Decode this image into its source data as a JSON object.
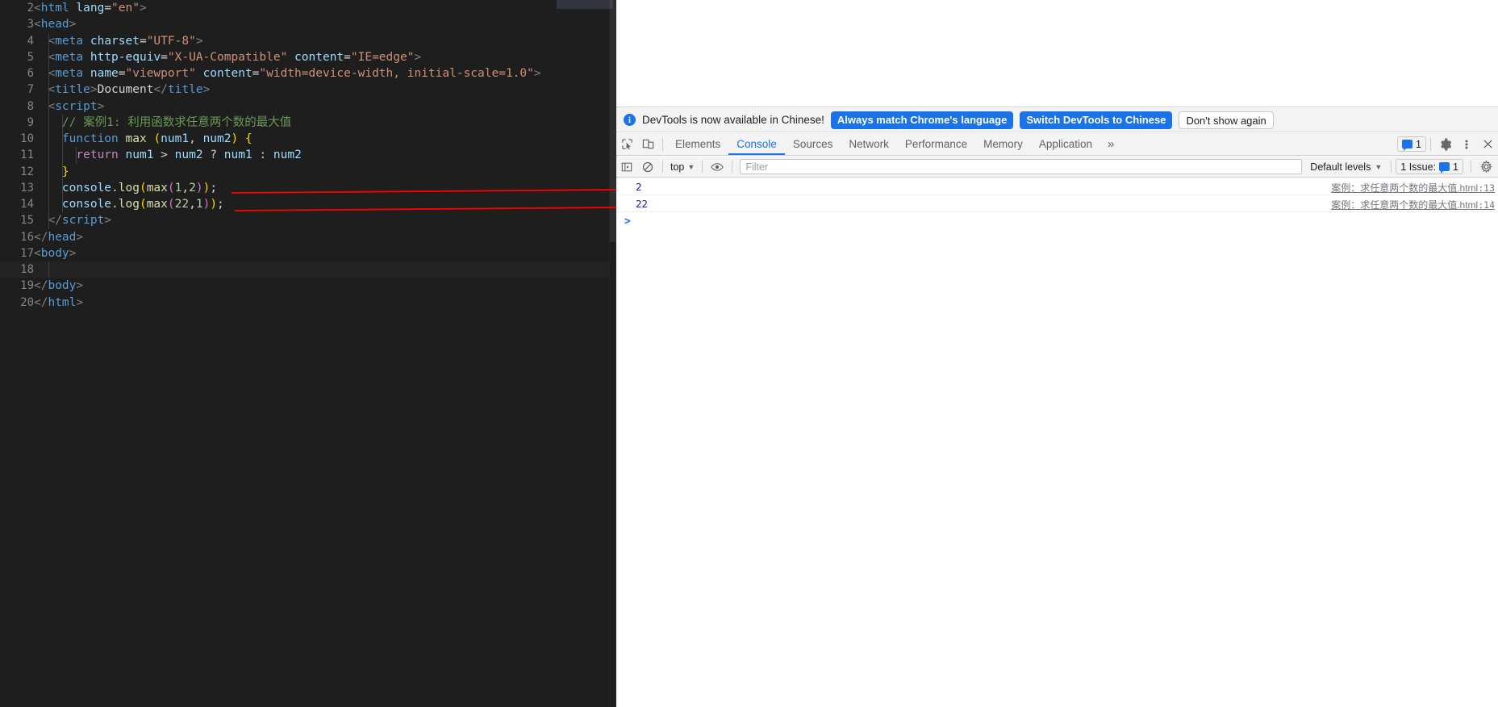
{
  "editor": {
    "first_visible_line": 2,
    "active_line": 18,
    "lines": [
      {
        "n": 2,
        "indent": 0,
        "tokens": [
          {
            "t": "punc",
            "s": "<"
          },
          {
            "t": "tag",
            "s": "html"
          },
          {
            "t": "plain",
            "s": " "
          },
          {
            "t": "attr",
            "s": "lang"
          },
          {
            "t": "plain",
            "s": "="
          },
          {
            "t": "str",
            "s": "\"en\""
          },
          {
            "t": "punc",
            "s": ">"
          }
        ]
      },
      {
        "n": 3,
        "indent": 0,
        "tokens": [
          {
            "t": "punc",
            "s": "<"
          },
          {
            "t": "tag",
            "s": "head"
          },
          {
            "t": "punc",
            "s": ">"
          }
        ]
      },
      {
        "n": 4,
        "indent": 1,
        "tokens": [
          {
            "t": "punc",
            "s": "  <"
          },
          {
            "t": "tag",
            "s": "meta"
          },
          {
            "t": "plain",
            "s": " "
          },
          {
            "t": "attr",
            "s": "charset"
          },
          {
            "t": "plain",
            "s": "="
          },
          {
            "t": "str",
            "s": "\"UTF-8\""
          },
          {
            "t": "punc",
            "s": ">"
          }
        ]
      },
      {
        "n": 5,
        "indent": 1,
        "tokens": [
          {
            "t": "punc",
            "s": "  <"
          },
          {
            "t": "tag",
            "s": "meta"
          },
          {
            "t": "plain",
            "s": " "
          },
          {
            "t": "attr",
            "s": "http-equiv"
          },
          {
            "t": "plain",
            "s": "="
          },
          {
            "t": "str",
            "s": "\"X-UA-Compatible\""
          },
          {
            "t": "plain",
            "s": " "
          },
          {
            "t": "attr",
            "s": "content"
          },
          {
            "t": "plain",
            "s": "="
          },
          {
            "t": "str",
            "s": "\"IE=edge\""
          },
          {
            "t": "punc",
            "s": ">"
          }
        ]
      },
      {
        "n": 6,
        "indent": 1,
        "tokens": [
          {
            "t": "punc",
            "s": "  <"
          },
          {
            "t": "tag",
            "s": "meta"
          },
          {
            "t": "plain",
            "s": " "
          },
          {
            "t": "attr",
            "s": "name"
          },
          {
            "t": "plain",
            "s": "="
          },
          {
            "t": "str",
            "s": "\"viewport\""
          },
          {
            "t": "plain",
            "s": " "
          },
          {
            "t": "attr",
            "s": "content"
          },
          {
            "t": "plain",
            "s": "="
          },
          {
            "t": "str",
            "s": "\"width=device-width, initial-scale=1.0\""
          },
          {
            "t": "punc",
            "s": ">"
          }
        ]
      },
      {
        "n": 7,
        "indent": 1,
        "tokens": [
          {
            "t": "punc",
            "s": "  <"
          },
          {
            "t": "tag",
            "s": "title"
          },
          {
            "t": "punc",
            "s": ">"
          },
          {
            "t": "plain",
            "s": "Document"
          },
          {
            "t": "punc",
            "s": "</"
          },
          {
            "t": "tag",
            "s": "title"
          },
          {
            "t": "punc",
            "s": ">"
          }
        ]
      },
      {
        "n": 8,
        "indent": 1,
        "tokens": [
          {
            "t": "punc",
            "s": "  <"
          },
          {
            "t": "tag",
            "s": "script"
          },
          {
            "t": "punc",
            "s": ">"
          }
        ]
      },
      {
        "n": 9,
        "indent": 2,
        "tokens": [
          {
            "t": "com",
            "s": "    // 案例1: 利用函数求任意两个数的最大值"
          }
        ]
      },
      {
        "n": 10,
        "indent": 2,
        "tokens": [
          {
            "t": "plain",
            "s": "    "
          },
          {
            "t": "kw",
            "s": "function"
          },
          {
            "t": "plain",
            "s": " "
          },
          {
            "t": "fn",
            "s": "max"
          },
          {
            "t": "plain",
            "s": " "
          },
          {
            "t": "br1",
            "s": "("
          },
          {
            "t": "var",
            "s": "num1"
          },
          {
            "t": "plain",
            "s": ", "
          },
          {
            "t": "var",
            "s": "num2"
          },
          {
            "t": "br1",
            "s": ")"
          },
          {
            "t": "plain",
            "s": " "
          },
          {
            "t": "br1",
            "s": "{"
          }
        ]
      },
      {
        "n": 11,
        "indent": 3,
        "tokens": [
          {
            "t": "plain",
            "s": "      "
          },
          {
            "t": "kwp",
            "s": "return"
          },
          {
            "t": "plain",
            "s": " "
          },
          {
            "t": "var",
            "s": "num1"
          },
          {
            "t": "plain",
            "s": " > "
          },
          {
            "t": "var",
            "s": "num2"
          },
          {
            "t": "plain",
            "s": " ? "
          },
          {
            "t": "var",
            "s": "num1"
          },
          {
            "t": "plain",
            "s": " : "
          },
          {
            "t": "var",
            "s": "num2"
          }
        ]
      },
      {
        "n": 12,
        "indent": 2,
        "tokens": [
          {
            "t": "plain",
            "s": "    "
          },
          {
            "t": "br1",
            "s": "}"
          }
        ]
      },
      {
        "n": 13,
        "indent": 2,
        "tokens": [
          {
            "t": "plain",
            "s": "    "
          },
          {
            "t": "obj",
            "s": "console"
          },
          {
            "t": "plain",
            "s": "."
          },
          {
            "t": "fn",
            "s": "log"
          },
          {
            "t": "br1",
            "s": "("
          },
          {
            "t": "fn",
            "s": "max"
          },
          {
            "t": "br2",
            "s": "("
          },
          {
            "t": "num",
            "s": "1"
          },
          {
            "t": "plain",
            "s": ","
          },
          {
            "t": "num",
            "s": "2"
          },
          {
            "t": "br2",
            "s": ")"
          },
          {
            "t": "br1",
            "s": ")"
          },
          {
            "t": "plain",
            "s": ";"
          }
        ]
      },
      {
        "n": 14,
        "indent": 2,
        "tokens": [
          {
            "t": "plain",
            "s": "    "
          },
          {
            "t": "obj",
            "s": "console"
          },
          {
            "t": "plain",
            "s": "."
          },
          {
            "t": "fn",
            "s": "log"
          },
          {
            "t": "br1",
            "s": "("
          },
          {
            "t": "fn",
            "s": "max"
          },
          {
            "t": "br2",
            "s": "("
          },
          {
            "t": "num",
            "s": "22"
          },
          {
            "t": "plain",
            "s": ","
          },
          {
            "t": "num",
            "s": "1"
          },
          {
            "t": "br2",
            "s": ")"
          },
          {
            "t": "br1",
            "s": ")"
          },
          {
            "t": "plain",
            "s": ";"
          }
        ]
      },
      {
        "n": 15,
        "indent": 1,
        "tokens": [
          {
            "t": "punc",
            "s": "  </"
          },
          {
            "t": "tag",
            "s": "script"
          },
          {
            "t": "punc",
            "s": ">"
          }
        ]
      },
      {
        "n": 16,
        "indent": 0,
        "tokens": [
          {
            "t": "punc",
            "s": "</"
          },
          {
            "t": "tag",
            "s": "head"
          },
          {
            "t": "punc",
            "s": ">"
          }
        ]
      },
      {
        "n": 17,
        "indent": 0,
        "tokens": [
          {
            "t": "punc",
            "s": "<"
          },
          {
            "t": "tag",
            "s": "body"
          },
          {
            "t": "punc",
            "s": ">"
          }
        ]
      },
      {
        "n": 18,
        "indent": 1,
        "tokens": [
          {
            "t": "plain",
            "s": "  "
          }
        ]
      },
      {
        "n": 19,
        "indent": 0,
        "tokens": [
          {
            "t": "punc",
            "s": "</"
          },
          {
            "t": "tag",
            "s": "body"
          },
          {
            "t": "punc",
            "s": ">"
          }
        ]
      },
      {
        "n": 20,
        "indent": 0,
        "tokens": [
          {
            "t": "punc",
            "s": "</"
          },
          {
            "t": "tag",
            "s": "html"
          },
          {
            "t": "punc",
            "s": ">"
          }
        ]
      }
    ]
  },
  "annotations": {
    "arrow_color": "#ff0000",
    "arrows": [
      {
        "label": "arrow-from-line-13-to-console-2",
        "from_line": 13,
        "to_message": "2"
      },
      {
        "label": "arrow-from-line-14-to-console-22",
        "from_line": 14,
        "to_message": "22"
      }
    ]
  },
  "devtools": {
    "banner": {
      "icon": "info-icon",
      "text": "DevTools is now available in Chinese!",
      "primary_button": "Always match Chrome's language",
      "secondary_button": "Switch DevTools to Chinese",
      "dismiss_button": "Don't show again",
      "accent_color": "#1a73e8"
    },
    "toolbar_icons": {
      "inspect": "inspect-element-icon",
      "device": "device-toolbar-icon"
    },
    "tabs": [
      {
        "label": "Elements",
        "active": false
      },
      {
        "label": "Console",
        "active": true
      },
      {
        "label": "Sources",
        "active": false
      },
      {
        "label": "Network",
        "active": false
      },
      {
        "label": "Performance",
        "active": false
      },
      {
        "label": "Memory",
        "active": false
      },
      {
        "label": "Application",
        "active": false
      }
    ],
    "overflow_tabs_label": "»",
    "issues_badge": {
      "count": "1",
      "icon": "message-badge-icon"
    },
    "settings_icon": "gear-icon",
    "kebab_icon": "more-options-icon",
    "close_icon": "close-icon",
    "console_toolbar": {
      "sidebar_toggle_icon": "console-sidebar-icon",
      "clear_icon": "clear-console-icon",
      "context": "top",
      "eye_icon": "live-expression-icon",
      "filter_placeholder": "Filter",
      "filter_value": "",
      "levels": "Default levels",
      "issues_text": "1 Issue:",
      "issues_count": "1"
    },
    "messages": [
      {
        "value": "2",
        "source_name": "案例：求任意两个数的最大值.html",
        "source_line": ":13"
      },
      {
        "value": "22",
        "source_name": "案例：求任意两个数的最大值.html",
        "source_line": ":14"
      }
    ],
    "prompt": ">"
  }
}
